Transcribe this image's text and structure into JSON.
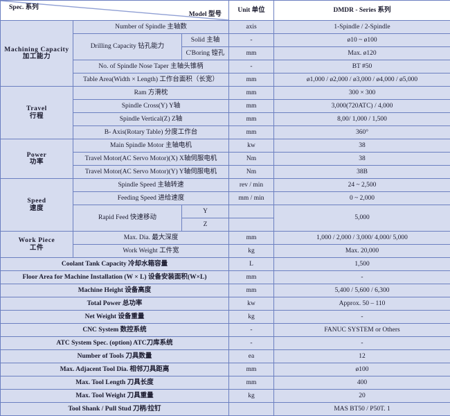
{
  "document": {
    "type": "specification-table",
    "title": "DMDR - Series Machine Specification Table"
  },
  "colors": {
    "row_background": "#d6dcef",
    "header_background": "#ffffff",
    "border": "#6b7fc0",
    "text": "#1a1a2e"
  },
  "header": {
    "spec_label": "Spec. 系列",
    "model_label": "Model 型号",
    "unit_label": "Unit 单位",
    "series_label": "DMDR - Series 系列"
  },
  "groups": [
    {
      "en": "Machining Capacity",
      "cn": "加工能力",
      "rows": [
        {
          "item": "Number of Spindle  主轴数",
          "sub": "",
          "unit": "axis",
          "value": "1-Spindle / 2-Spindle"
        },
        {
          "item": "Drilling Capacity  钻孔能力",
          "sub": "Solid  主轴",
          "unit": "-",
          "value": "ø10 ~ ø100"
        },
        {
          "item": "",
          "sub": "C'Boring  镗孔",
          "unit": "mm",
          "value": "Max. ø120"
        },
        {
          "item": "No. of Spindle Nose Taper  主轴头锥柄",
          "sub": "",
          "unit": "-",
          "value": "BT #50"
        },
        {
          "item": "Table Area(Width × Length)  工作台面积（长宽）",
          "sub": "",
          "unit": "mm",
          "value": "ø1,000 / ø2,000 / ø3,000 / ø4,000 / ø5,000"
        }
      ]
    },
    {
      "en": "Travel",
      "cn": "行程",
      "rows": [
        {
          "item": "Ram  方滑枕",
          "sub": "",
          "unit": "mm",
          "value": "300 × 300"
        },
        {
          "item": "Spindle Cross(Y)  Y轴",
          "sub": "",
          "unit": "mm",
          "value": "3,000(720ATC) / 4,000"
        },
        {
          "item": "Spindle Vertical(Z)  Z轴",
          "sub": "",
          "unit": "mm",
          "value": "8,00/ 1,000 / 1,500"
        },
        {
          "item": "B- Axis(Rotary Table)  分度工作台",
          "sub": "",
          "unit": "mm",
          "value": "360°"
        }
      ]
    },
    {
      "en": "Power",
      "cn": "功率",
      "rows": [
        {
          "item": "Main Spindle Motor  主轴电机",
          "sub": "",
          "unit": "kw",
          "value": "38"
        },
        {
          "item": "Travel Motor(AC Servo Motor)(X)  X轴伺服电机",
          "sub": "",
          "unit": "Nm",
          "value": "38"
        },
        {
          "item": "Travel Motor(AC Servo Motor)(Y)  Y轴伺服电机",
          "sub": "",
          "unit": "Nm",
          "value": "38B"
        }
      ]
    },
    {
      "en": "Speed",
      "cn": "速度",
      "rows": [
        {
          "item": "Spindle Speed  主轴转速",
          "sub": "",
          "unit": "rev / min",
          "value": "24 ~ 2,500"
        },
        {
          "item": "Feeding Speed  进给速度",
          "sub": "",
          "unit": "mm / min",
          "value": "0 ~ 2,000"
        },
        {
          "item": "Rapid Feed  快速移动",
          "sub": "Y",
          "unit": "",
          "value": "5,000"
        },
        {
          "item": "",
          "sub": "Z",
          "unit": "",
          "value": ""
        }
      ]
    },
    {
      "en": "Work Piece",
      "cn": "工件",
      "rows": [
        {
          "item": "Max. Dia.  最大深度",
          "sub": "",
          "unit": "mm",
          "value": "1,000 / 2,000 / 3,000/ 4,000/ 5,000"
        },
        {
          "item": "Work Weight  工件宽",
          "sub": "",
          "unit": "kg",
          "value": "Max. 20,000"
        }
      ]
    }
  ],
  "full_rows": [
    {
      "item": "Coolant Tank Capacity  冷却水箱容量",
      "unit": "L",
      "value": "1,500"
    },
    {
      "item": "Floor Area for Machine Installation (W × L)  设备安装面积(W×L)",
      "unit": "mm",
      "value": "-"
    },
    {
      "item": "Machine Height  设备高度",
      "unit": "mm",
      "value": "5,400 / 5,600 / 6,300"
    },
    {
      "item": "Total Power  总功率",
      "unit": "kw",
      "value": "Approx. 50 – 110"
    },
    {
      "item": "Net Weight  设备重量",
      "unit": "kg",
      "value": "-"
    },
    {
      "item": "CNC System  数控系统",
      "unit": "-",
      "value": "FANUC SYSTEM or Others"
    },
    {
      "item": "ATC  System Spec. (option)  ATC刀库系统",
      "unit": "-",
      "value": "-"
    },
    {
      "item": "Number of Tools  刀具数量",
      "unit": "ea",
      "value": "12"
    },
    {
      "item": "Max. Adjacent Tool Dia.  相邻刀具距离",
      "unit": "mm",
      "value": "ø100"
    },
    {
      "item": "Max. Tool Length  刀具长度",
      "unit": "mm",
      "value": "400"
    },
    {
      "item": "Max. Tool Weight  刀具重量",
      "unit": "kg",
      "value": "20"
    },
    {
      "item": "Tool Shank / Pull Stud  刀柄/拉钉",
      "unit": "",
      "value": "MAS  BT50 / P50T. 1"
    }
  ]
}
